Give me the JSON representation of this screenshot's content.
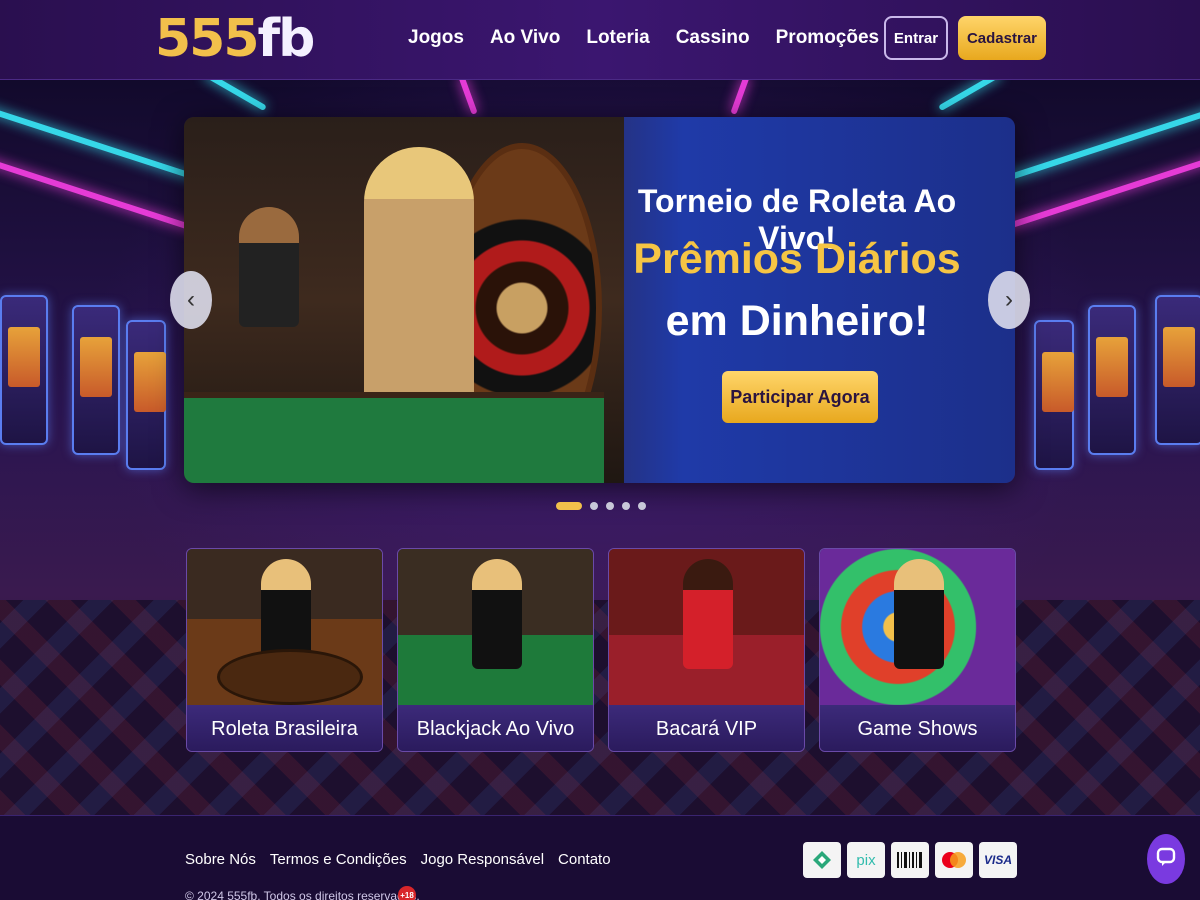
{
  "header": {
    "logo_num": "555",
    "logo_fb": "fb",
    "nav": [
      "Jogos",
      "Ao Vivo",
      "Loteria",
      "Cassino",
      "Promoções"
    ],
    "login_label": "Entrar",
    "signup_label": "Cadastrar"
  },
  "hero": {
    "title": "Torneio de Roleta Ao Vivo!",
    "subtitle_line1": "Prêmios Diários",
    "subtitle_line2": "em Dinheiro!",
    "cta_label": "Participar Agora",
    "prev_icon": "chevron-left-icon",
    "next_icon": "chevron-right-icon",
    "slide_count": 5,
    "active_slide": 1
  },
  "categories": [
    {
      "label": "Roleta Brasileira"
    },
    {
      "label": "Blackjack Ao Vivo"
    },
    {
      "label": "Bacará VIP"
    },
    {
      "label": "Game Shows"
    }
  ],
  "footer": {
    "links": [
      "Sobre Nós",
      "Termos e Condições",
      "Jogo Responsável",
      "Contato"
    ],
    "copyright": "© 2024 555fb. Todos os direitos reservados.",
    "age_badge": "+18",
    "payments": [
      "bank-icon",
      "pix",
      "boleto",
      "mastercard",
      "VISA"
    ]
  },
  "colors": {
    "accent_gold": "#f2c04b",
    "header_purple": "#3b1670",
    "chat_purple": "#7a3ae0"
  }
}
